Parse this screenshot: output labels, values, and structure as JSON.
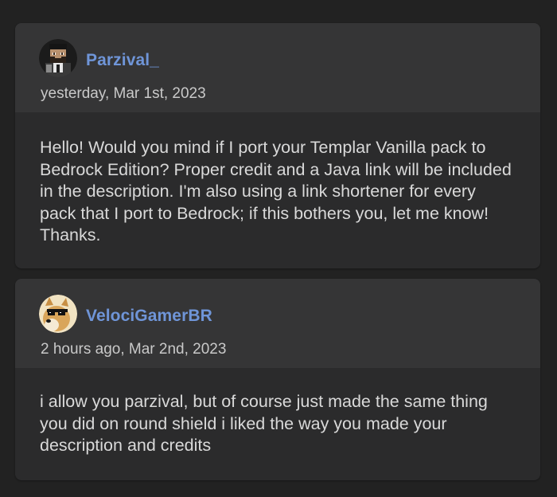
{
  "comments": [
    {
      "username": "Parzival_",
      "timestamp": "yesterday, Mar 1st, 2023",
      "avatar_icon": "pixel-character-avatar-icon",
      "body": "Hello! Would you mind if I port your Templar Vanilla pack to Bedrock Edition? Proper credit and a Java link will be included in the description. I'm also using a link shortener for every pack that I port to Bedrock; if this bothers you, let me know! Thanks."
    },
    {
      "username": "VelociGamerBR",
      "timestamp": "2 hours ago, Mar 2nd, 2023",
      "avatar_icon": "doge-sunglasses-avatar-icon",
      "body": "i allow you parzival, but of course just made the same thing you did on round shield i liked the way you made your description and credits"
    }
  ],
  "colors": {
    "page_background": "#222222",
    "card_background": "#2b2b2c",
    "header_background": "#353536",
    "username": "#6f95d8",
    "timestamp": "#c9c9c9",
    "body_text": "#d9d9d9"
  }
}
